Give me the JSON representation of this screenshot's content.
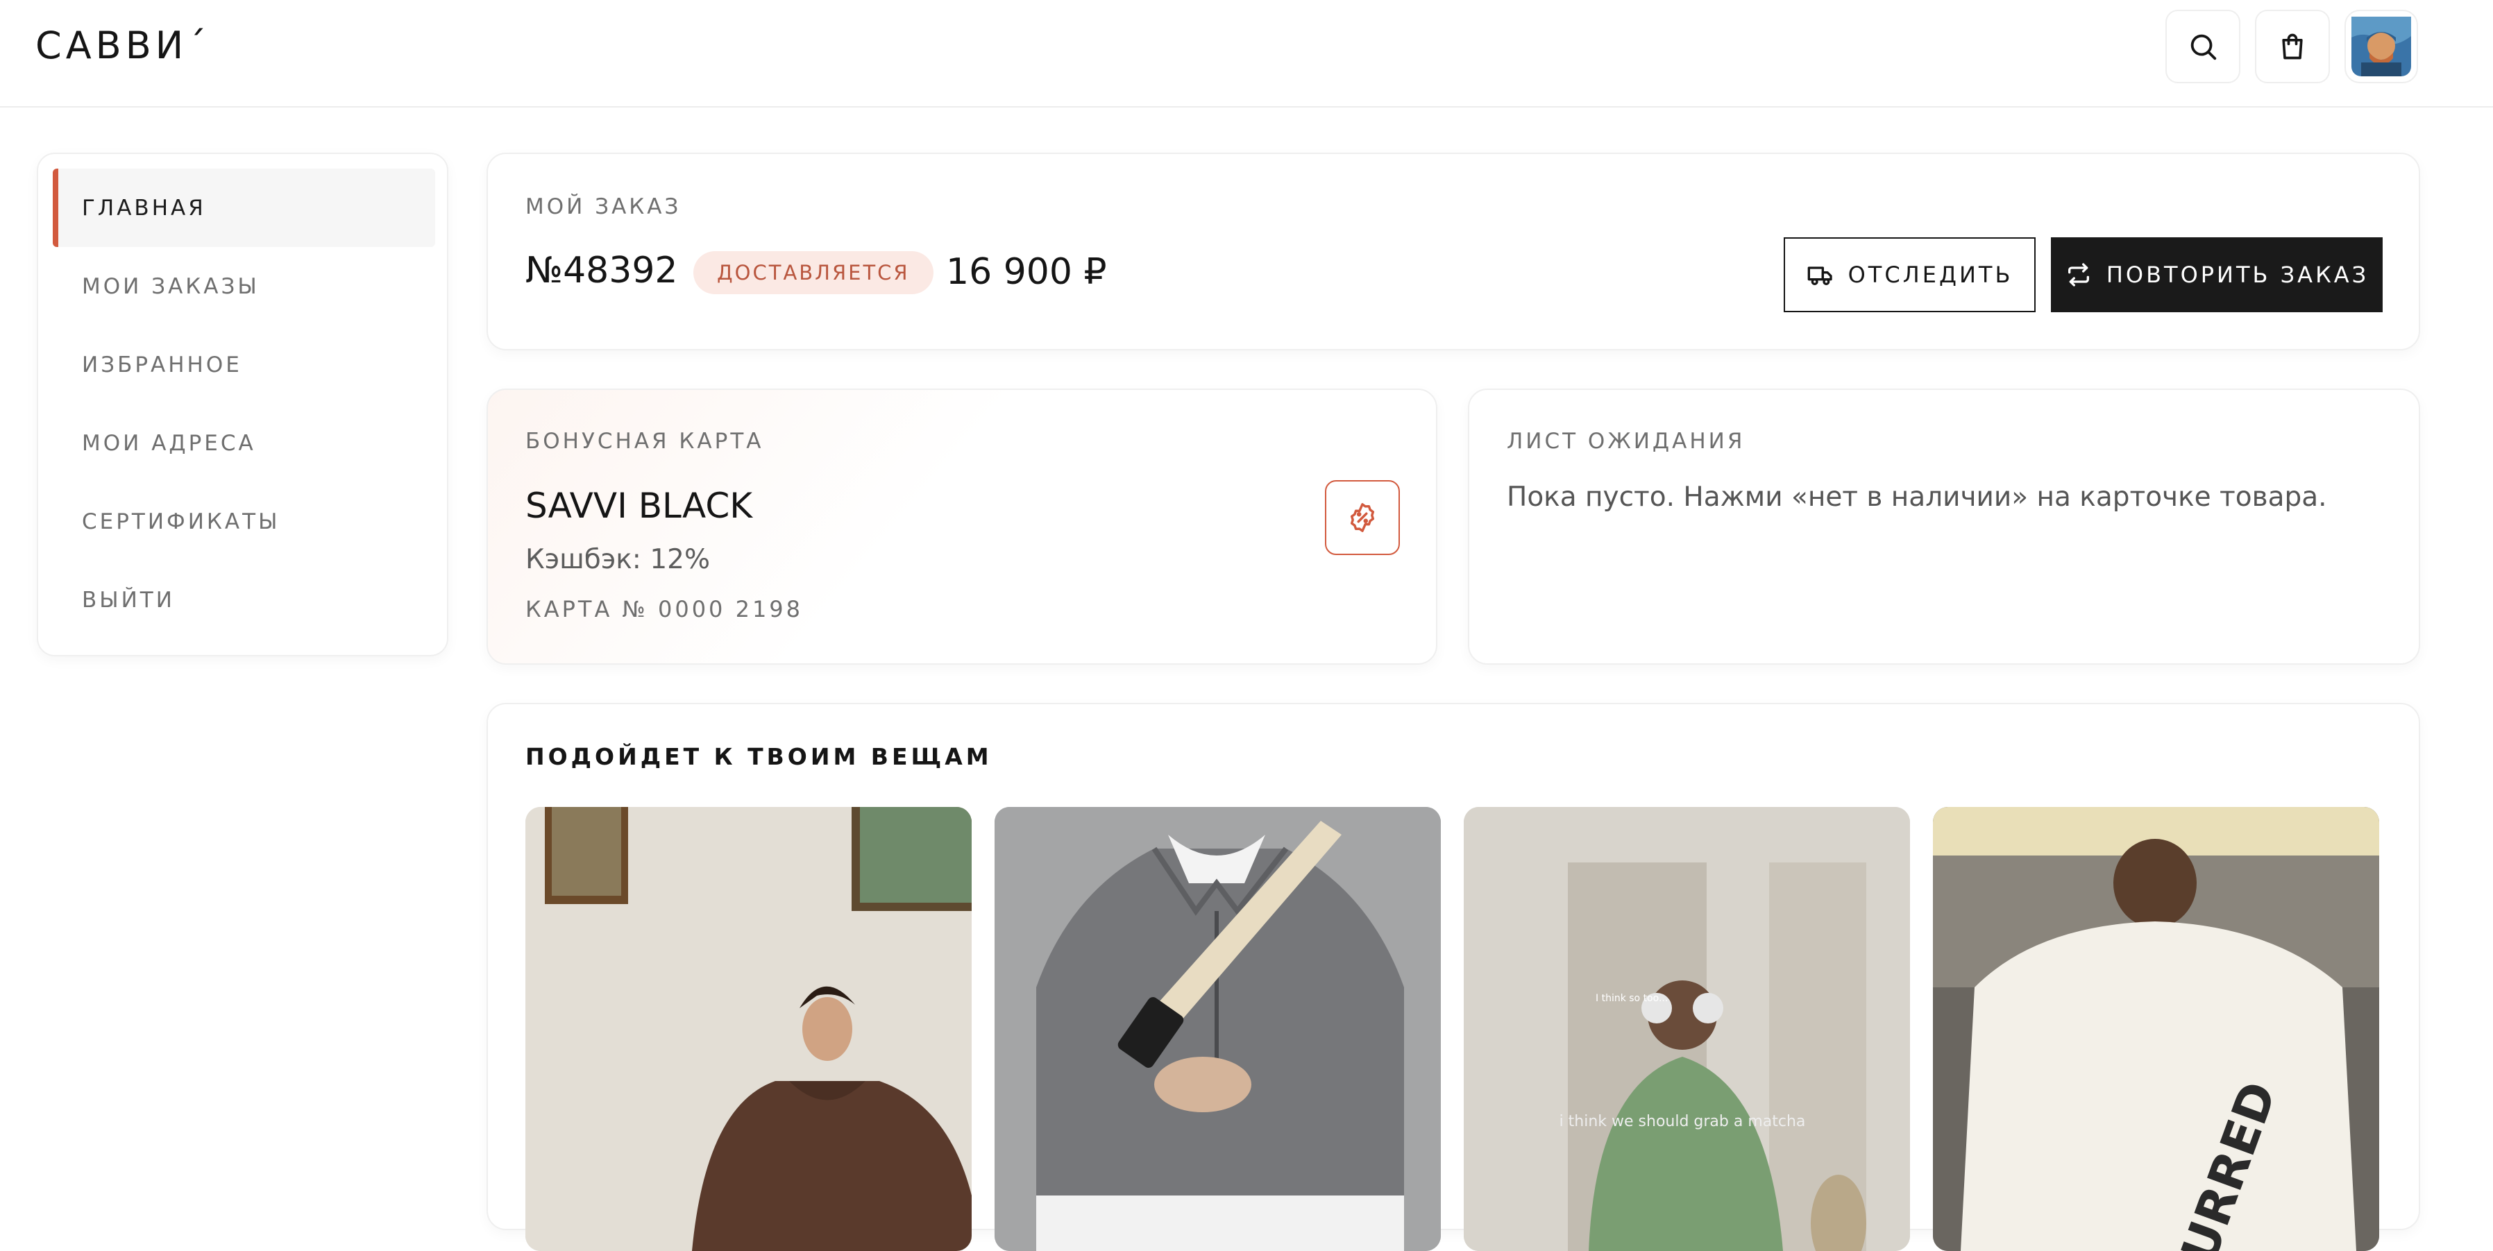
{
  "brand": {
    "logo": "САВВИ´"
  },
  "header": {
    "search_icon": "search-icon",
    "cart_icon": "shopping-bag-icon",
    "avatar_icon": "user-avatar"
  },
  "sidebar": {
    "items": [
      {
        "label": "ГЛАВНАЯ",
        "active": true
      },
      {
        "label": "МОИ ЗАКАЗЫ",
        "active": false
      },
      {
        "label": "ИЗБРАННОЕ",
        "active": false
      },
      {
        "label": "МОИ АДРЕСА",
        "active": false
      },
      {
        "label": "СЕРТИФИКАТЫ",
        "active": false
      },
      {
        "label": "ВЫЙТИ",
        "active": false
      }
    ]
  },
  "order": {
    "caption": "МОЙ ЗАКАЗ",
    "number": "№48392",
    "status": "ДОСТАВЛЯЕТСЯ",
    "price": "16 900 ₽",
    "track_label": "ОТСЛЕДИТЬ",
    "repeat_label": "ПОВТОРИТЬ ЗАКАЗ"
  },
  "bonus": {
    "caption": "БОНУСНАЯ КАРТА",
    "card_name": "SAVVI BLACK",
    "cashback": "Кэшбэк: 12%",
    "card_number": "КАРТА № 0000 2198",
    "icon": "discount-badge-icon"
  },
  "waitlist": {
    "caption": "ЛИСТ ОЖИДАНИЯ",
    "text": "Пока пусто. Нажми «нет в наличии» на карточке товара."
  },
  "recommendations": {
    "title": "ПОДОЙДЕТ К ТВОИМ ВЕЩАМ",
    "products": [
      {
        "name": "brown-hoodie-photo"
      },
      {
        "name": "grey-fleece-zip-photo"
      },
      {
        "name": "green-sweatshirt-photo",
        "print_text": "i think we should grab a matcha",
        "label_text": "I think so too..."
      },
      {
        "name": "white-tshirt-photo",
        "print_text": "BURRED"
      }
    ]
  },
  "colors": {
    "accent": "#d25a3e",
    "badge_bg": "#fbe9e4",
    "dark_button": "#1a1a1a"
  }
}
